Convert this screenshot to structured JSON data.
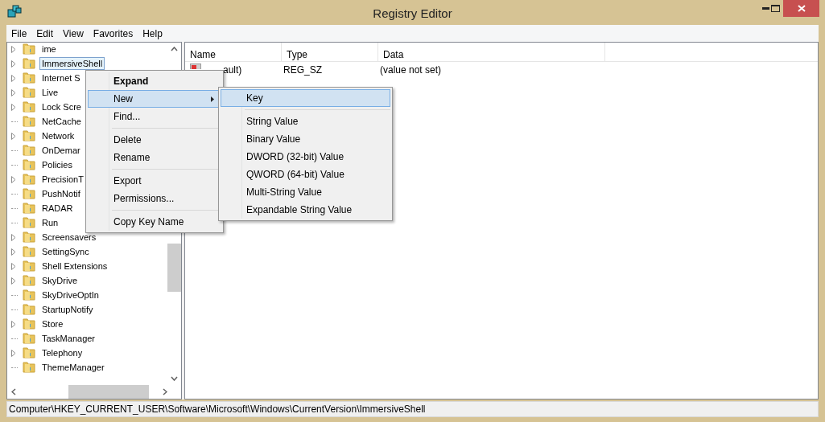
{
  "window": {
    "title": "Registry Editor"
  },
  "menu_bar": [
    "File",
    "Edit",
    "View",
    "Favorites",
    "Help"
  ],
  "tree": [
    {
      "label": "ime",
      "has_children": true,
      "selected": false
    },
    {
      "label": "ImmersiveShell",
      "has_children": true,
      "selected": true
    },
    {
      "label": "Internet S",
      "has_children": true,
      "selected": false
    },
    {
      "label": "Live",
      "has_children": true,
      "selected": false
    },
    {
      "label": "Lock Scre",
      "has_children": true,
      "selected": false
    },
    {
      "label": "NetCache",
      "has_children": false,
      "selected": false
    },
    {
      "label": "Network",
      "has_children": true,
      "selected": false
    },
    {
      "label": "OnDemar",
      "has_children": false,
      "selected": false
    },
    {
      "label": "Policies",
      "has_children": false,
      "selected": false
    },
    {
      "label": "PrecisionT",
      "has_children": true,
      "selected": false
    },
    {
      "label": "PushNotif",
      "has_children": false,
      "selected": false
    },
    {
      "label": "RADAR",
      "has_children": false,
      "selected": false
    },
    {
      "label": "Run",
      "has_children": false,
      "selected": false
    },
    {
      "label": "Screensavers",
      "has_children": true,
      "selected": false
    },
    {
      "label": "SettingSync",
      "has_children": true,
      "selected": false
    },
    {
      "label": "Shell Extensions",
      "has_children": true,
      "selected": false
    },
    {
      "label": "SkyDrive",
      "has_children": true,
      "selected": false
    },
    {
      "label": "SkyDriveOptIn",
      "has_children": false,
      "selected": false
    },
    {
      "label": "StartupNotify",
      "has_children": false,
      "selected": false
    },
    {
      "label": "Store",
      "has_children": true,
      "selected": false
    },
    {
      "label": "TaskManager",
      "has_children": false,
      "selected": false
    },
    {
      "label": "Telephony",
      "has_children": true,
      "selected": false
    },
    {
      "label": "ThemeManager",
      "has_children": false,
      "selected": false
    }
  ],
  "values": {
    "columns": [
      "Name",
      "Type",
      "Data"
    ],
    "rows": [
      {
        "name": "ault)",
        "type": "REG_SZ",
        "data": "(value not set)"
      }
    ]
  },
  "context_menu": [
    {
      "kind": "item",
      "label": "Expand",
      "default": true,
      "selected": false,
      "submenu": false
    },
    {
      "kind": "item",
      "label": "New",
      "default": false,
      "selected": true,
      "submenu": true
    },
    {
      "kind": "item",
      "label": "Find...",
      "default": false,
      "selected": false,
      "submenu": false
    },
    {
      "kind": "separator"
    },
    {
      "kind": "item",
      "label": "Delete",
      "default": false,
      "selected": false,
      "submenu": false
    },
    {
      "kind": "item",
      "label": "Rename",
      "default": false,
      "selected": false,
      "submenu": false
    },
    {
      "kind": "separator"
    },
    {
      "kind": "item",
      "label": "Export",
      "default": false,
      "selected": false,
      "submenu": false
    },
    {
      "kind": "item",
      "label": "Permissions...",
      "default": false,
      "selected": false,
      "submenu": false
    },
    {
      "kind": "separator"
    },
    {
      "kind": "item",
      "label": "Copy Key Name",
      "default": false,
      "selected": false,
      "submenu": false
    }
  ],
  "submenu": [
    {
      "kind": "item",
      "label": "Key",
      "default": false,
      "selected": true,
      "submenu": false
    },
    {
      "kind": "separator"
    },
    {
      "kind": "item",
      "label": "String Value",
      "default": false,
      "selected": false,
      "submenu": false
    },
    {
      "kind": "item",
      "label": "Binary Value",
      "default": false,
      "selected": false,
      "submenu": false
    },
    {
      "kind": "item",
      "label": "DWORD (32-bit) Value",
      "default": false,
      "selected": false,
      "submenu": false
    },
    {
      "kind": "item",
      "label": "QWORD (64-bit) Value",
      "default": false,
      "selected": false,
      "submenu": false
    },
    {
      "kind": "item",
      "label": "Multi-String Value",
      "default": false,
      "selected": false,
      "submenu": false
    },
    {
      "kind": "item",
      "label": "Expandable String Value",
      "default": false,
      "selected": false,
      "submenu": false
    }
  ],
  "status_bar": "Computer\\HKEY_CURRENT_USER\\Software\\Microsoft\\Windows\\CurrentVersion\\ImmersiveShell"
}
